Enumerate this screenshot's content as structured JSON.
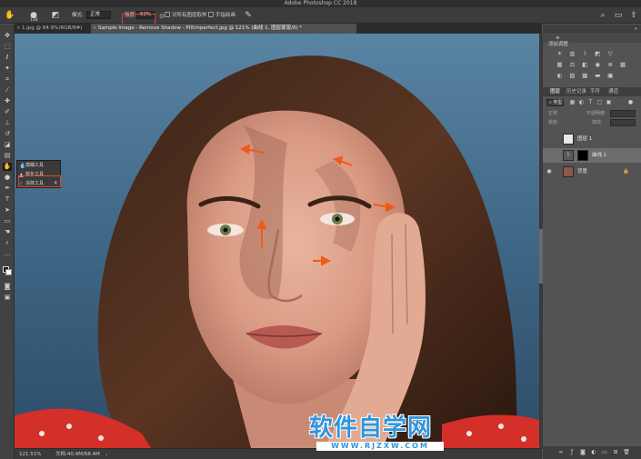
{
  "app": {
    "title": "Adobe Photoshop CC 2018"
  },
  "options_bar": {
    "brush_size": "128",
    "mode_label": "模式:",
    "mode_value": "正常",
    "strength_label": "强度:",
    "strength_value": "50%",
    "sample_all_layers": "对所有图层取样",
    "finger_painting": "手指绘画"
  },
  "tabs": [
    {
      "label": "1.jpg @ 84.9%(RGB/8#) *",
      "active": false
    },
    {
      "label": "Sample Image - Remove Shadow - PIXimperfect.jpg @ 121% (曲线 1, 图层蒙版/8) *",
      "active": true
    }
  ],
  "flyout": {
    "items": [
      {
        "label": "模糊工具",
        "key": ""
      },
      {
        "label": "锐化工具",
        "key": ""
      },
      {
        "label": "涂抹工具",
        "key": "R"
      }
    ]
  },
  "status": {
    "zoom": "121.51%",
    "doc": "文档:40.4M/68.4M"
  },
  "adjustments": {
    "title": "添加调整"
  },
  "layers_panel": {
    "tabs": [
      "图层",
      "历史记录",
      "字符",
      "通道"
    ],
    "filter_label": "类型",
    "blend_label": "正常",
    "opacity_label": "不透明度:",
    "fill_label": "填充:",
    "lock_label": "锁定:",
    "layers": [
      {
        "name": "图层 1",
        "selected": false
      },
      {
        "name": "曲线 1",
        "selected": true
      },
      {
        "name": "背景",
        "selected": false
      }
    ]
  },
  "watermark": {
    "title": "软件自学网",
    "url": "WWW.RJZXW.COM"
  },
  "colors": {
    "highlight": "#e8402d",
    "accent_blue": "#2f95dd"
  }
}
